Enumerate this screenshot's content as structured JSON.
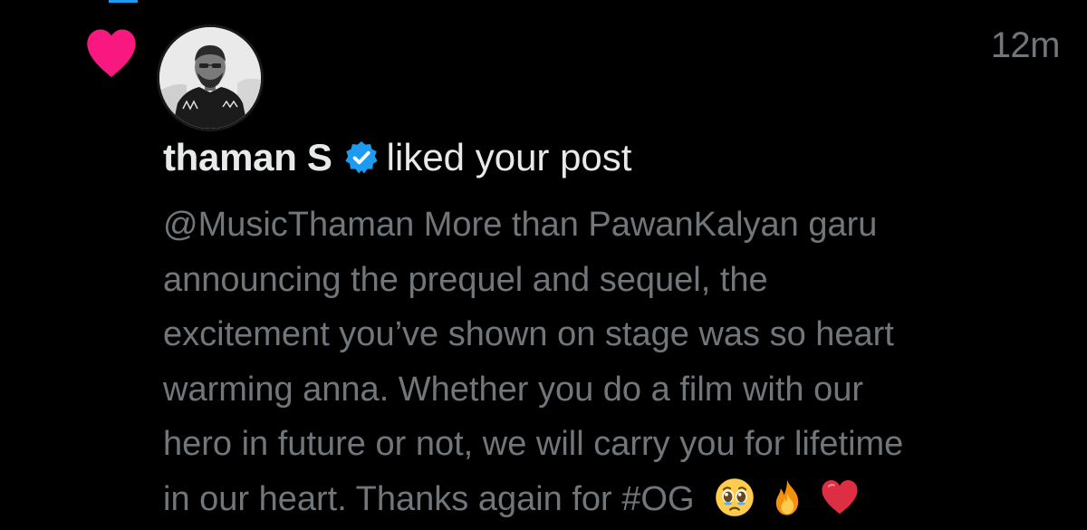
{
  "notification": {
    "type": "like",
    "timestamp": "12m",
    "actor": {
      "name": "thaman S",
      "verified": true
    },
    "action": "liked your post",
    "post": {
      "lines": [
        "@MusicThaman More than PawanKalyan garu",
        "announcing the prequel and sequel, the",
        "excitement you’ve shown on stage was so heart",
        "warming anna. Whether you do a film with our",
        "hero in future or not, we will carry you for lifetime",
        "in our heart. Thanks again for #OG"
      ],
      "emojis": [
        "pleading-face",
        "fire",
        "red-heart"
      ]
    }
  },
  "colors": {
    "background": "#000000",
    "like_heart": "#f91880",
    "verified_badge": "#1d9bf0",
    "primary_text": "#e7e9ea",
    "secondary_text": "#71767b"
  },
  "icons": {
    "like": "heart-icon",
    "verified": "verified-badge-icon"
  }
}
